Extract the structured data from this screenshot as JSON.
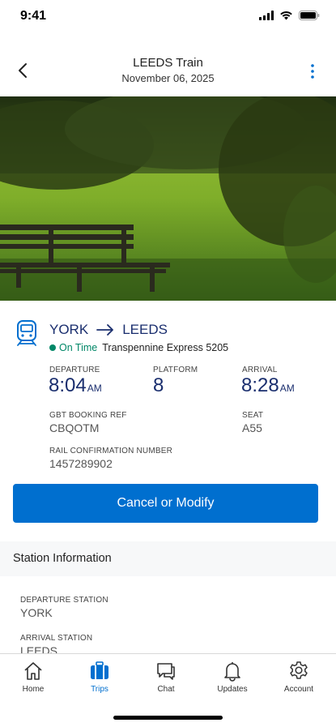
{
  "status_bar": {
    "time": "9:41"
  },
  "header": {
    "title": "LEEDS Train",
    "date": "November 06, 2025"
  },
  "trip": {
    "origin": "YORK",
    "destination": "LEEDS",
    "status": "On Time",
    "train": "Transpennine Express 5205",
    "departure_label": "DEPARTURE",
    "departure_time": "8:04",
    "departure_ampm": "AM",
    "platform_label": "PLATFORM",
    "platform": "8",
    "arrival_label": "ARRIVAL",
    "arrival_time": "8:28",
    "arrival_ampm": "AM",
    "booking_label": "GBT BOOKING REF",
    "booking_ref": "CBQOTM",
    "seat_label": "SEAT",
    "seat": "A55",
    "confirmation_label": "RAIL CONFIRMATION NUMBER",
    "confirmation_number": "1457289902"
  },
  "cta": {
    "label": "Cancel or Modify"
  },
  "station_info": {
    "title": "Station Information",
    "departure_station_label": "DEPARTURE STATION",
    "departure_station": "YORK",
    "arrival_station_label": "ARRIVAL STATION",
    "arrival_station": "LEEDS"
  },
  "tabs": [
    {
      "label": "Home",
      "icon": "home-icon"
    },
    {
      "label": "Trips",
      "icon": "suitcase-icon"
    },
    {
      "label": "Chat",
      "icon": "chat-icon"
    },
    {
      "label": "Updates",
      "icon": "bell-icon"
    },
    {
      "label": "Account",
      "icon": "gear-icon"
    }
  ],
  "colors": {
    "brand_blue": "#006fcf",
    "navy": "#1a2e6e",
    "on_time_green": "#008767"
  }
}
